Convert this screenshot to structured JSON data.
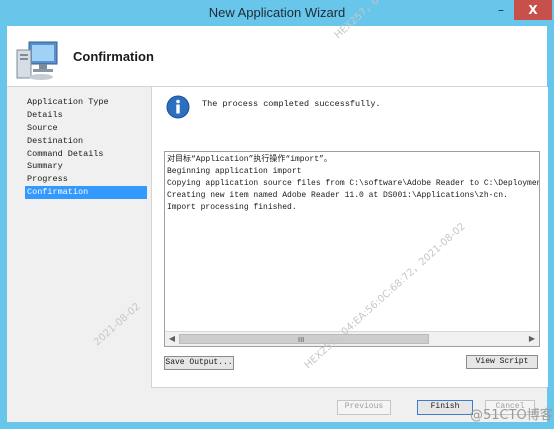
{
  "window": {
    "title": "New Application Wizard",
    "minimize_glyph": "–",
    "close_glyph": "X"
  },
  "header": {
    "title": "Confirmation",
    "icon": "computer-icon"
  },
  "nav": {
    "items": [
      {
        "label": "Application Type",
        "active": false
      },
      {
        "label": "Details",
        "active": false
      },
      {
        "label": "Source",
        "active": false
      },
      {
        "label": "Destination",
        "active": false
      },
      {
        "label": "Command Details",
        "active": false
      },
      {
        "label": "Summary",
        "active": false
      },
      {
        "label": "Progress",
        "active": false
      },
      {
        "label": "Confirmation",
        "active": true
      }
    ]
  },
  "status": {
    "icon": "info-icon",
    "message": "The process completed successfully."
  },
  "log": {
    "lines": [
      "对目标“Application”执行操作“import”。",
      "Beginning application import",
      "Copying application source files from C:\\software\\Adobe Reader to C:\\DeploymentSha",
      "Creating new item named Adobe Reader 11.0 at DS001:\\Applications\\zh-cn.",
      "Import processing finished."
    ],
    "scroll_grip": "III"
  },
  "buttons": {
    "save_output": "Save Output...",
    "view_script": "View Script",
    "previous": "Previous",
    "finish": "Finish",
    "cancel": "Cancel"
  },
  "watermarks": {
    "line1": "HEX257，04:EA:56:0C:68:72，2021-08-02",
    "line2": "2021-08-02",
    "logo": "@51CTO博客"
  },
  "colors": {
    "title_bar": "#68c6ea",
    "close_button": "#c7504b",
    "nav_active": "#3399ff",
    "info_icon": "#2a6fc0"
  }
}
